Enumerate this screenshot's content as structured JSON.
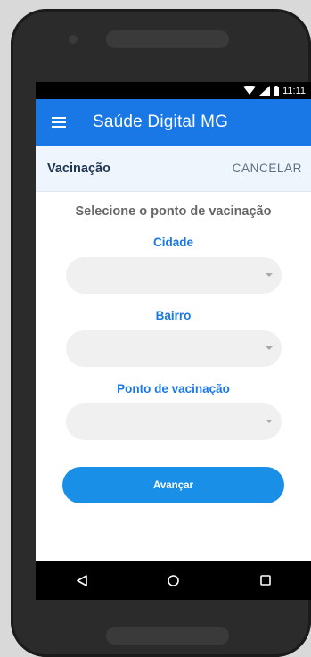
{
  "status_bar": {
    "time": "11:11"
  },
  "app_bar": {
    "title": "Saúde Digital MG"
  },
  "subheader": {
    "title": "Vacinação",
    "cancel_label": "CANCELAR"
  },
  "form": {
    "heading": "Selecione o ponto de vacinação",
    "fields": [
      {
        "label": "Cidade",
        "value": ""
      },
      {
        "label": "Bairro",
        "value": ""
      },
      {
        "label": "Ponto de vacinação",
        "value": ""
      }
    ],
    "submit_label": "Avançar"
  },
  "nav_bar": {
    "icons": [
      "back-icon",
      "home-icon",
      "recents-icon"
    ]
  },
  "colors": {
    "primary": "#1a78e6",
    "button": "#1a8fe8",
    "subheader_bg": "#eef5fd"
  }
}
